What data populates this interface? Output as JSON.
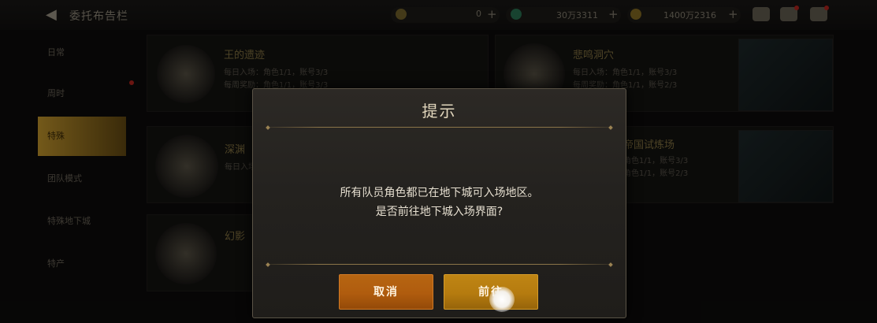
{
  "header": {
    "title": "委托布告栏",
    "currencies": [
      {
        "icon": "moon-coin-icon",
        "value": "0",
        "color": "#c9a54a"
      },
      {
        "icon": "green-gem-icon",
        "value": "30万3311",
        "color": "#3bb07a"
      },
      {
        "icon": "gold-coin-icon",
        "value": "1400万2316",
        "color": "#d4a933"
      }
    ],
    "plus": "+"
  },
  "sidebar": {
    "items": [
      {
        "label": "日常",
        "active": false
      },
      {
        "label": "周时",
        "active": false,
        "dot": true
      },
      {
        "label": "特殊",
        "active": true
      },
      {
        "label": "团队模式",
        "active": false
      },
      {
        "label": "特殊地下城",
        "active": false
      },
      {
        "label": "特产",
        "active": false
      }
    ]
  },
  "cards": [
    {
      "name": "王的遗迹",
      "line1": "每日入场：角色1/1，账号3/3",
      "line2": "每周奖励：角色1/1，账号3/3"
    },
    {
      "name": "悲鸣洞穴",
      "line1": "每日入场：角色1/1，账号3/3",
      "line2": "每周奖励：角色1/1，账号2/3"
    },
    {
      "name": "深渊",
      "line1": "每日入场",
      "line2": ""
    },
    {
      "name": "帝国试炼场",
      "line1": "角色1/1，账号3/3",
      "line2": "角色1/1，账号2/3"
    },
    {
      "name": "幻影",
      "line1": "",
      "line2": ""
    }
  ],
  "dialog": {
    "title": "提示",
    "message_line1": "所有队员角色都已在地下城可入场地区。",
    "message_line2": "是否前往地下城入场界面?",
    "cancel_label": "取消",
    "confirm_label": "前往"
  },
  "colors": {
    "accent_gold": "#d2a230",
    "cancel_button": "#b05c0e",
    "confirm_button": "#b57b0f",
    "dialog_border": "#5a5346"
  }
}
